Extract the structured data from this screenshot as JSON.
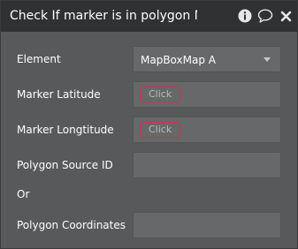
{
  "window": {
    "title": "Check If marker is in polygon Ma",
    "icons": [
      "info-icon",
      "comment-icon",
      "close-icon"
    ]
  },
  "fields": {
    "element": {
      "label": "Element",
      "value": "MapBoxMap A"
    },
    "marker_latitude": {
      "label": "Marker Latitude",
      "button": "Click"
    },
    "marker_longitude": {
      "label": "Marker Longtitude",
      "button": "Click"
    },
    "polygon_source_id": {
      "label": "Polygon Source ID",
      "value": ""
    },
    "or_text": "Or",
    "polygon_coordinates": {
      "label": "Polygon Coordinates",
      "value": ""
    }
  },
  "colors": {
    "panel_bg": "#57595b",
    "titlebar_bg": "#2f3133",
    "field_bg": "#666869",
    "accent_red": "#d0324c"
  }
}
